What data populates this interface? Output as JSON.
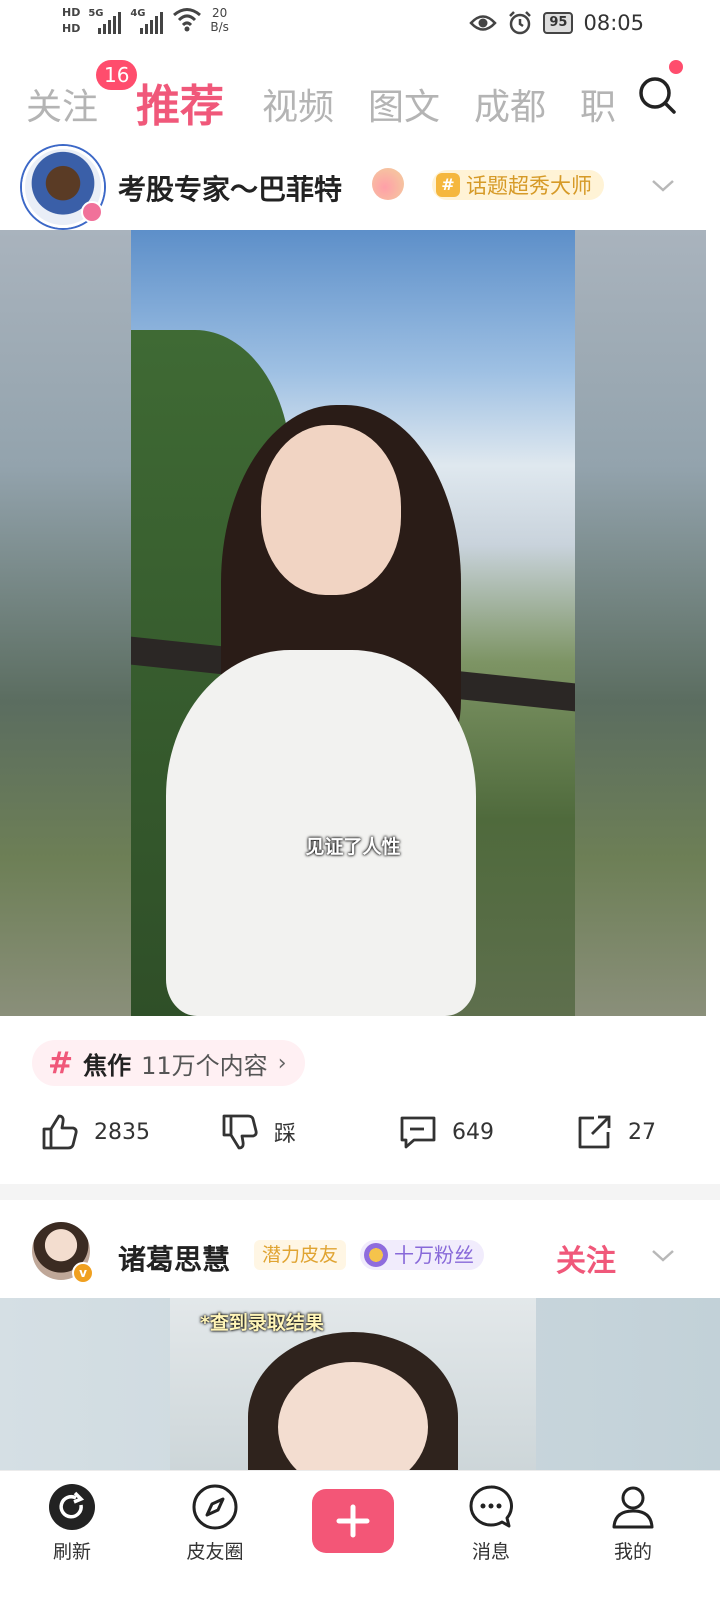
{
  "status_bar": {
    "hd1": "HD",
    "hd2": "HD",
    "signal1_label": "5G",
    "signal2_label": "4G",
    "net_speed_value": "20",
    "net_speed_unit": "B/s",
    "battery": "95",
    "time": "08:05",
    "icons": [
      "eye-icon",
      "alarm-icon",
      "battery-icon",
      "wifi-icon"
    ]
  },
  "top_tabs": {
    "follow": "关注",
    "follow_badge": "16",
    "recommend": "推荐",
    "video": "视频",
    "image_text": "图文",
    "chengdu": "成都",
    "job": "职",
    "active_color": "#f0587a"
  },
  "post1": {
    "username": "考股专家～巴菲特",
    "topic_badge": "话题超秀大师",
    "subtitle": "见证了人性",
    "topic_tag": {
      "name": "焦作",
      "count": "11万个内容",
      "arrow": "›"
    },
    "actions": {
      "like": "2835",
      "dislike": "踩",
      "comment": "649",
      "share": "27"
    }
  },
  "post2": {
    "username": "诸葛思慧",
    "potential_tag": "潜力皮友",
    "fans_tag": "十万粉丝",
    "follow": "关注",
    "caption": "*查到录取结果"
  },
  "bottom_nav": {
    "refresh": "刷新",
    "circle": "皮友圈",
    "messages": "消息",
    "mine": "我的"
  }
}
